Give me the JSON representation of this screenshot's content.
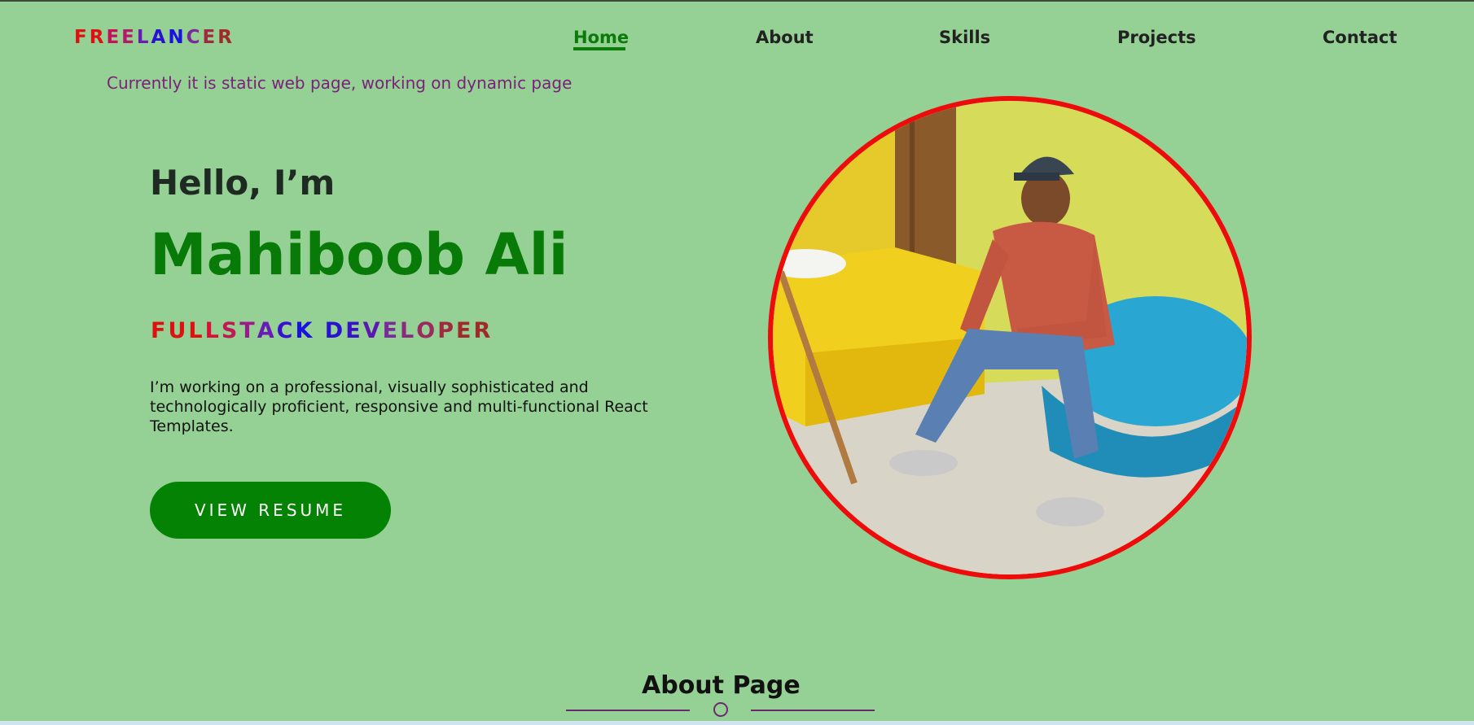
{
  "header": {
    "logo": [
      "F",
      "R",
      "E",
      "E",
      "L",
      "A",
      "N",
      "C",
      "E",
      "R"
    ],
    "logo_colors": [
      "#e01010",
      "#e01010",
      "#c8105a",
      "#b51a6a",
      "#6a1ab5",
      "#2a10d0",
      "#1a10e0",
      "#7a2a9a",
      "#a02a40",
      "#a02a2a"
    ],
    "nav": [
      {
        "label": "Home",
        "active": true
      },
      {
        "label": "About",
        "active": false
      },
      {
        "label": "Skills",
        "active": false
      },
      {
        "label": "Projects",
        "active": false
      },
      {
        "label": "Contact",
        "active": false
      }
    ]
  },
  "notice": "Currently it is static web page, working on dynamic page",
  "hero": {
    "greeting": "Hello, I’m",
    "name": "Mahiboob Ali",
    "role": [
      "F",
      "U",
      "L",
      "L",
      "S",
      "T",
      "A",
      "C",
      "K",
      " ",
      "D",
      "E",
      "V",
      "E",
      "L",
      "O",
      "P",
      "E",
      "R"
    ],
    "role_colors": [
      "#e01010",
      "#e01010",
      "#e01010",
      "#d8103a",
      "#c01a55",
      "#9a1a8a",
      "#6a1ab5",
      "#3a10d0",
      "#1a10e0",
      "#ffffff",
      "#2a10d0",
      "#3a10c8",
      "#5a18b0",
      "#7a2a9a",
      "#8a2a80",
      "#9a2a60",
      "#a02a40",
      "#a02a30",
      "#a02a2a"
    ],
    "description": "I’m working on a professional, visually sophisticated and technologically proficient, responsive and multi-functional React Templates.",
    "button": "VIEW RESUME"
  },
  "about": {
    "title": "About Page"
  },
  "colors": {
    "background": "#95d194",
    "accent_green": "#038203",
    "photo_border": "#ee0b0b"
  }
}
